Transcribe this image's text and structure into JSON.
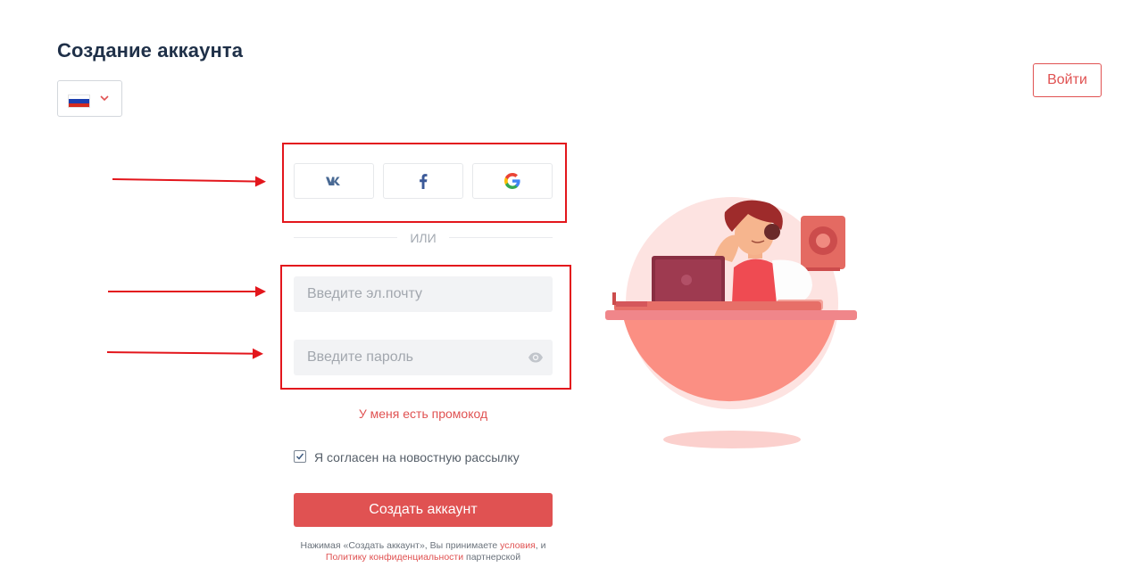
{
  "page": {
    "title": "Создание аккаунта",
    "login_label": "Войти"
  },
  "language": {
    "selected": "RU",
    "flag_icon": "russia-flag-icon",
    "dropdown_icon": "chevron-down-icon"
  },
  "social": {
    "vk": {
      "label": "VK",
      "icon": "vk-icon"
    },
    "facebook": {
      "label": "Facebook",
      "icon": "facebook-icon"
    },
    "google": {
      "label": "Google",
      "icon": "google-icon"
    }
  },
  "divider_text": "ИЛИ",
  "form": {
    "email": {
      "placeholder": "Введите эл.почту",
      "value": ""
    },
    "password": {
      "placeholder": "Введите пароль",
      "value": "",
      "icon": "eye-icon"
    },
    "promo_link": "У меня есть промокод",
    "newsletter": {
      "label": "Я согласен на новостную рассылку",
      "checked": true
    },
    "submit_label": "Создать аккаунт"
  },
  "terms": {
    "part1": "Нажимая «Создать аккаунт», Вы принимаете",
    "link1": "условия",
    "part2": ", и",
    "link2": "Политику конфиденциальности",
    "part3": "партнерской"
  },
  "colors": {
    "accent": "#e05252",
    "title": "#1f3048",
    "annotation": "#e3161c"
  }
}
